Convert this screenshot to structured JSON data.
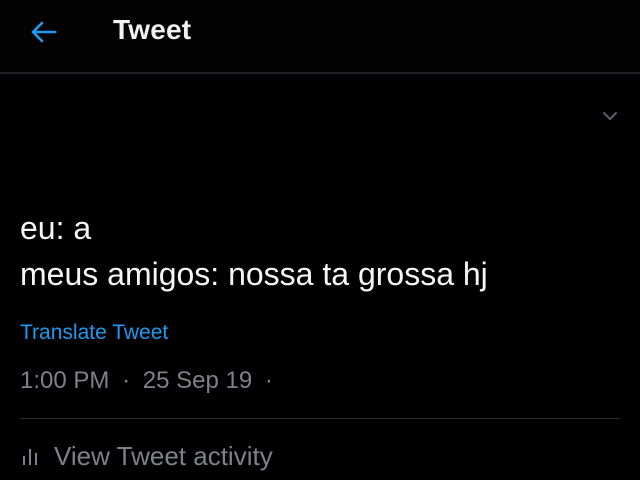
{
  "header": {
    "title": "Tweet",
    "back_icon": "arrow-left-icon",
    "accent": "#1d9bf0"
  },
  "tweet": {
    "more_icon": "chevron-down-icon",
    "lines": [
      "eu: a",
      "meus amigos: nossa ta grossa hj"
    ],
    "translate_label": "Translate Tweet",
    "time": "1:00 PM",
    "separator": "·",
    "date": "25 Sep 19",
    "trailing_separator": "·",
    "activity_icon": "bar-chart-icon",
    "activity_label": "View Tweet activity"
  }
}
